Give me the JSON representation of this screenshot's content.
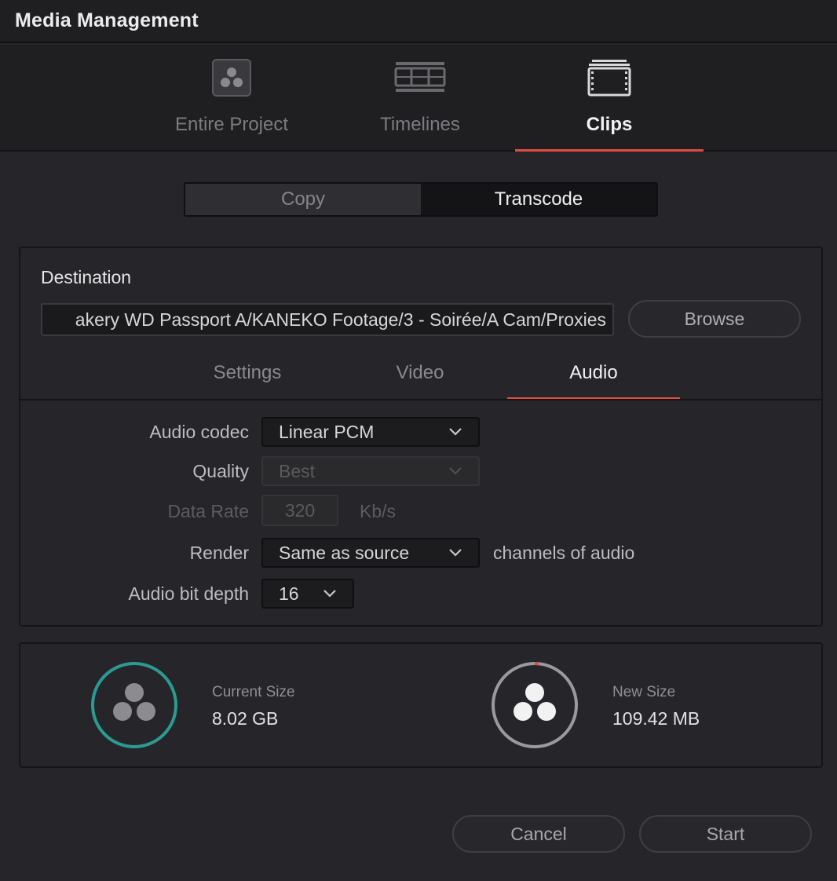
{
  "window": {
    "title": "Media Management"
  },
  "modes": [
    {
      "label": "Entire Project",
      "icon": "resolve-logo-icon",
      "active": false
    },
    {
      "label": "Timelines",
      "icon": "timeline-icon",
      "active": false
    },
    {
      "label": "Clips",
      "icon": "clips-icon",
      "active": true
    }
  ],
  "action": {
    "copy_label": "Copy",
    "transcode_label": "Transcode",
    "selected": "Transcode"
  },
  "destination": {
    "label": "Destination",
    "path": "akery WD Passport A/KANEKO Footage/3 - Soirée/A Cam/Proxies",
    "browse_label": "Browse"
  },
  "subtabs": [
    {
      "label": "Settings",
      "active": false
    },
    {
      "label": "Video",
      "active": false
    },
    {
      "label": "Audio",
      "active": true
    }
  ],
  "audio": {
    "codec_label": "Audio codec",
    "codec_value": "Linear PCM",
    "quality_label": "Quality",
    "quality_value": "Best",
    "data_rate_label": "Data Rate",
    "data_rate_value": "320",
    "data_rate_unit": "Kb/s",
    "render_label": "Render",
    "render_value": "Same as source",
    "render_suffix": "channels of audio",
    "bit_depth_label": "Audio bit depth",
    "bit_depth_value": "16"
  },
  "sizes": {
    "current_caption": "Current Size",
    "current_value": "8.02 GB",
    "new_caption": "New Size",
    "new_value": "109.42 MB"
  },
  "buttons": {
    "cancel_label": "Cancel",
    "start_label": "Start"
  },
  "colors": {
    "accent_red": "#e04c43",
    "current_ring": "#2b9a93",
    "new_ring": "#9a9a9e"
  }
}
